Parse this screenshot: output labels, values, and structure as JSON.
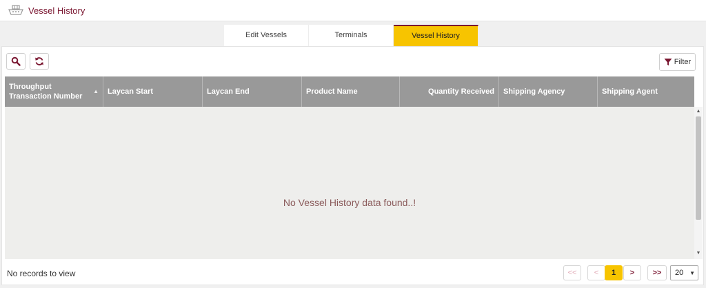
{
  "header": {
    "title": "Vessel History",
    "icon": "ship-icon"
  },
  "tabs": [
    {
      "label": "Edit Vessels",
      "active": false
    },
    {
      "label": "Terminals",
      "active": false
    },
    {
      "label": "Vessel History",
      "active": true
    }
  ],
  "toolbar": {
    "search_icon": "search-icon",
    "refresh_icon": "refresh-icon",
    "filter_label": "Filter",
    "filter_icon": "filter-icon"
  },
  "table": {
    "columns": [
      {
        "label": "Throughput Transaction Number",
        "sortable": true
      },
      {
        "label": "Laycan Start"
      },
      {
        "label": "Laycan End"
      },
      {
        "label": "Product Name"
      },
      {
        "label": "Quantity Received"
      },
      {
        "label": "Shipping Agency"
      },
      {
        "label": "Shipping Agent"
      }
    ],
    "rows": [],
    "empty_message": "No Vessel History data found..!"
  },
  "pagination": {
    "records_text": "No records to view",
    "first_label": "<<",
    "prev_label": "<",
    "current_page": "1",
    "next_label": ">",
    "last_label": ">>",
    "page_size": "20"
  },
  "colors": {
    "accent": "#f7c400",
    "brand": "#7a1630",
    "header_gray": "#999999"
  }
}
